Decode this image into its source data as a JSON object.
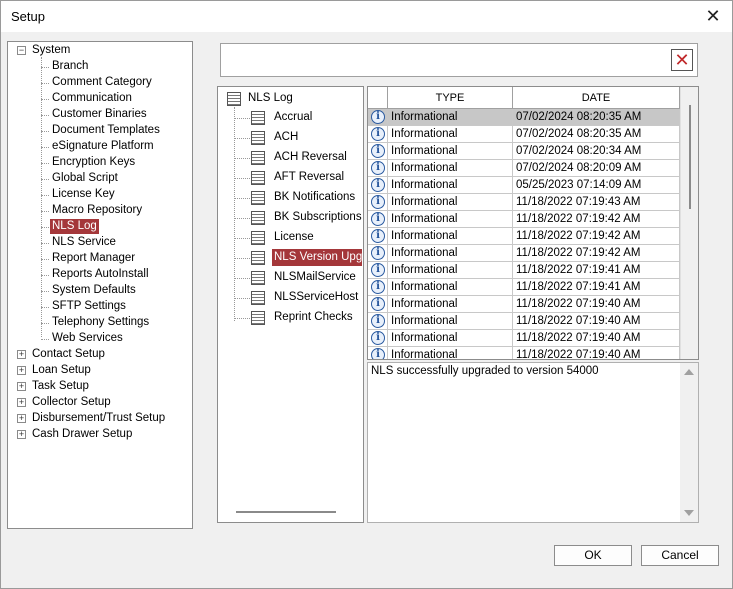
{
  "window": {
    "title": "Setup"
  },
  "left_tree": {
    "system": {
      "label": "System",
      "expander": "⊟"
    },
    "system_children": [
      "Branch",
      "Comment Category",
      "Communication",
      "Customer Binaries",
      "Document Templates",
      "eSignature Platform",
      "Encryption Keys",
      "Global Script",
      "License Key",
      "Macro Repository",
      "NLS Log",
      "NLS Service",
      "Report Manager",
      "Reports AutoInstall",
      "System Defaults",
      "SFTP Settings",
      "Telephony Settings",
      "Web Services"
    ],
    "selected_child": "NLS Log",
    "collapsed_roots": [
      "Contact Setup",
      "Loan Setup",
      "Task Setup",
      "Collector Setup",
      "Disbursement/Trust Setup",
      "Cash Drawer Setup"
    ],
    "collapsed_expander": "⊞"
  },
  "search": {
    "value": "",
    "clear_icon": "close-icon"
  },
  "log_list": {
    "root": "NLS Log",
    "items": [
      "Accrual",
      "ACH",
      "ACH Reversal",
      "AFT Reversal",
      "BK Notifications",
      "BK Subscriptions",
      "License",
      "NLS Version Upgra",
      "NLSMailService",
      "NLSServiceHost",
      "Reprint Checks"
    ],
    "selected": "NLS Version Upgra"
  },
  "grid": {
    "columns": [
      "TYPE",
      "DATE"
    ],
    "rows": [
      {
        "type": "Informational",
        "date": "07/02/2024  08:20:35 AM",
        "selected": true
      },
      {
        "type": "Informational",
        "date": "07/02/2024  08:20:35 AM"
      },
      {
        "type": "Informational",
        "date": "07/02/2024  08:20:34 AM"
      },
      {
        "type": "Informational",
        "date": "07/02/2024  08:20:09 AM"
      },
      {
        "type": "Informational",
        "date": "05/25/2023  07:14:09 AM"
      },
      {
        "type": "Informational",
        "date": "11/18/2022  07:19:43 AM"
      },
      {
        "type": "Informational",
        "date": "11/18/2022  07:19:42 AM"
      },
      {
        "type": "Informational",
        "date": "11/18/2022  07:19:42 AM"
      },
      {
        "type": "Informational",
        "date": "11/18/2022  07:19:42 AM"
      },
      {
        "type": "Informational",
        "date": "11/18/2022  07:19:41 AM"
      },
      {
        "type": "Informational",
        "date": "11/18/2022  07:19:41 AM"
      },
      {
        "type": "Informational",
        "date": "11/18/2022  07:19:40 AM"
      },
      {
        "type": "Informational",
        "date": "11/18/2022  07:19:40 AM"
      },
      {
        "type": "Informational",
        "date": "11/18/2022  07:19:40 AM"
      },
      {
        "type": "Informational",
        "date": "11/18/2022  07:19:40 AM"
      }
    ],
    "row_icon": "info-icon",
    "row_icon_glyph": "i"
  },
  "detail": {
    "text": "NLS successfully upgraded to version 54000"
  },
  "buttons": {
    "ok": "OK",
    "cancel": "Cancel"
  },
  "colors": {
    "selection": "#a4373a",
    "row_selected": "#c7c7c7"
  }
}
